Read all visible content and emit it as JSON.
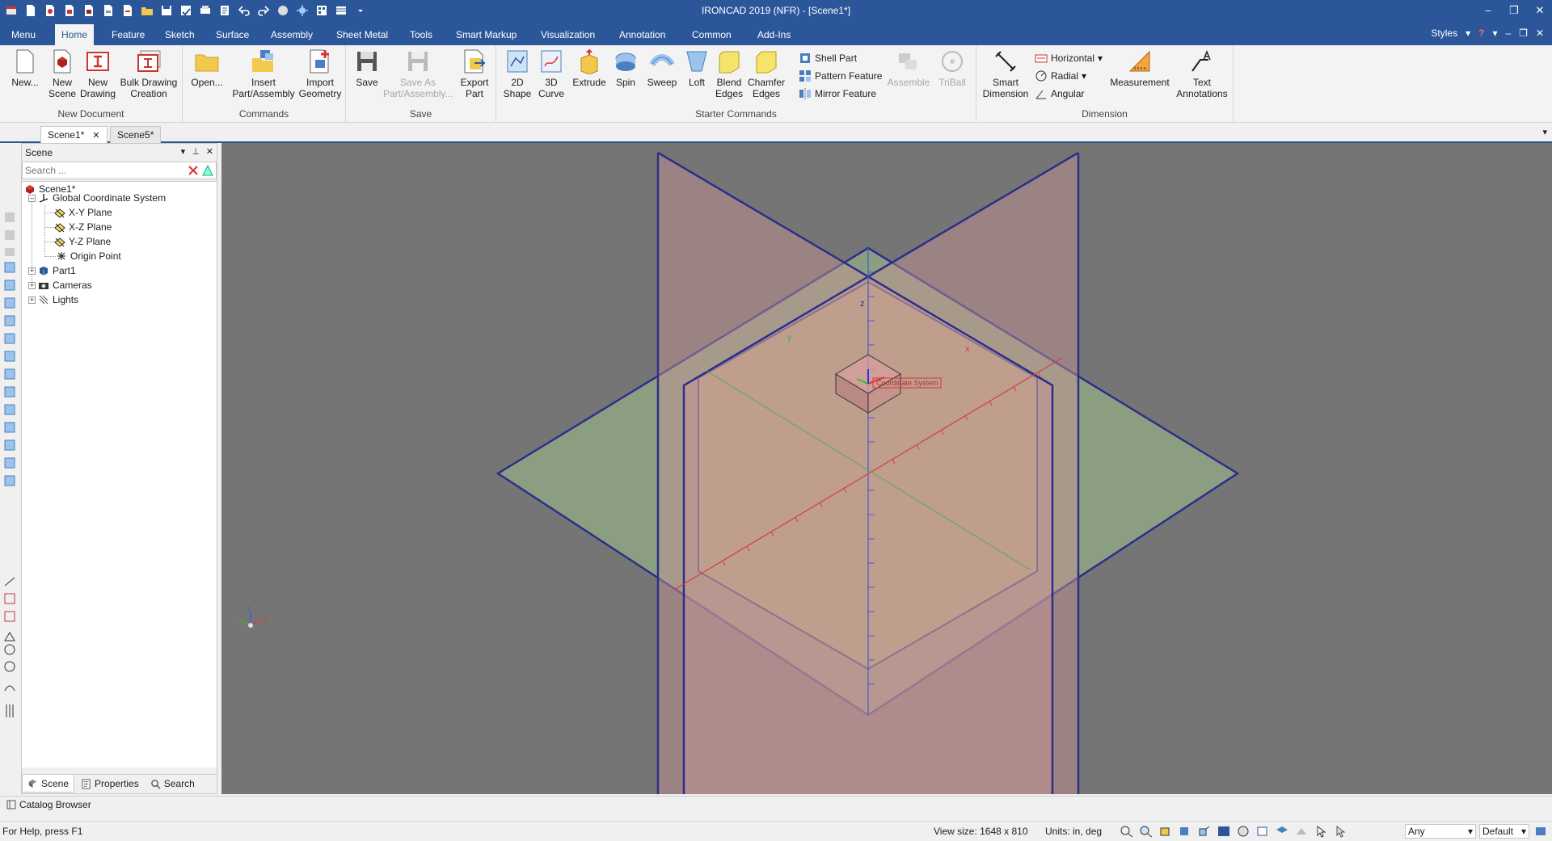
{
  "window": {
    "title": "IRONCAD 2019 (NFR) - [Scene1*]",
    "controls": [
      "–",
      "❐",
      "✕"
    ]
  },
  "ribbon_tabs": [
    "Menu",
    "Home",
    "Feature",
    "Sketch",
    "Surface",
    "Assembly",
    "Sheet Metal",
    "Tools",
    "Smart Markup",
    "Visualization",
    "Annotation",
    "Common",
    "Add-Ins"
  ],
  "active_tab": "Home",
  "styles_label": "Styles",
  "ribbon": {
    "new_document": {
      "label": "New Document",
      "buttons": [
        "New...",
        "New\nScene",
        "New\nDrawing",
        "Bulk Drawing\nCreation"
      ]
    },
    "commands": {
      "label": "Commands",
      "buttons": [
        "Open...",
        "Insert\nPart/Assembly",
        "Import\nGeometry"
      ]
    },
    "save": {
      "label": "Save",
      "buttons": [
        "Save",
        "Save As\nPart/Assembly...",
        "Export\nPart"
      ]
    },
    "starter": {
      "label": "Starter Commands",
      "buttons": [
        "2D\nShape",
        "3D\nCurve",
        "Extrude",
        "Spin",
        "Sweep",
        "Loft",
        "Blend\nEdges",
        "Chamfer\nEdges"
      ],
      "small": [
        "Shell Part",
        "Pattern Feature",
        "Mirror Feature"
      ],
      "disabled": [
        "Assemble",
        "TriBall"
      ]
    },
    "dimension": {
      "label": "Dimension",
      "buttons": [
        "Smart\nDimension",
        "Measurement",
        "Text\nAnnotations"
      ],
      "small": [
        "Horizontal",
        "Radial",
        "Angular"
      ]
    }
  },
  "doc_tabs": [
    "Scene1*",
    "Scene5*"
  ],
  "scene_panel": {
    "title": "Scene",
    "search_placeholder": "Search ...",
    "tree": {
      "root": "Scene1*",
      "gcs": "Global Coordinate System",
      "xy": "X-Y Plane",
      "xz": "X-Z Plane",
      "yz": "Y-Z Plane",
      "origin": "Origin Point",
      "part": "Part1",
      "cameras": "Cameras",
      "lights": "Lights"
    },
    "footer_tabs": [
      "Scene",
      "Properties",
      "Search"
    ]
  },
  "viewport": {
    "axis_z": "z",
    "axis_x": "x",
    "axis_y": "y",
    "gcs_tag": "Coordinate System",
    "colors": {
      "background": "#757575",
      "plane_edge": "#2e2e8a",
      "xy_plane": "#9fbf8a",
      "vertical_plane": "#c99595",
      "x_axis": "#d04040",
      "y_axis": "#40b040",
      "z_axis": "#4060d0"
    }
  },
  "catalog_browser": "Catalog Browser",
  "status": {
    "help": "For Help, press F1",
    "view_size": "View size: 1648 x  810",
    "units": "Units: in, deg",
    "filter": "Any",
    "style": "Default"
  }
}
